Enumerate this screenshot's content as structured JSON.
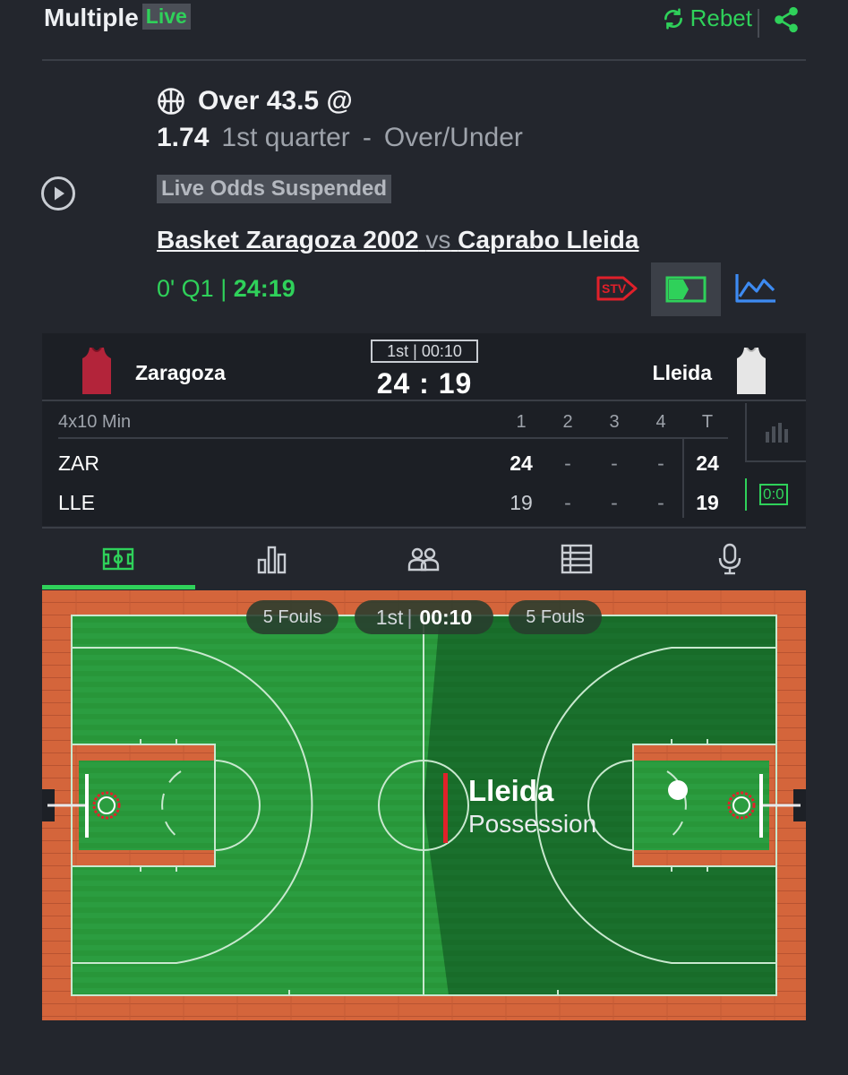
{
  "header": {
    "title": "Multiple",
    "live_badge": "Live",
    "rebet_label": "Rebet"
  },
  "bet": {
    "selection": "Over 43.5 @",
    "odds": "1.74",
    "period": "1st quarter",
    "separator": "-",
    "market": "Over/Under",
    "status": "Live Odds Suspended",
    "home_team": "Basket Zaragoza 2002",
    "vs": "vs",
    "away_team": "Caprabo Lleida",
    "clock_prefix": "0' Q1 |",
    "clock_time": "24:19"
  },
  "scoreboard": {
    "home": "Zaragoza",
    "away": "Lleida",
    "period_box": "1st | 00:10",
    "score": "24 : 19",
    "format": "4x10 Min",
    "headers": [
      "1",
      "2",
      "3",
      "4",
      "T"
    ],
    "rows": [
      {
        "abbr": "ZAR",
        "q1": "24",
        "q2": "-",
        "q3": "-",
        "q4": "-",
        "total": "24"
      },
      {
        "abbr": "LLE",
        "q1": "19",
        "q2": "-",
        "q3": "-",
        "q4": "-",
        "total": "19"
      }
    ],
    "serve_indicator": "0:0",
    "home_color": "#b3243a",
    "away_color": "#e6e6e6"
  },
  "tabs": [
    {
      "icon": "court-icon",
      "active": true
    },
    {
      "icon": "stats-bars-icon",
      "active": false
    },
    {
      "icon": "lineups-icon",
      "active": false
    },
    {
      "icon": "table-icon",
      "active": false
    },
    {
      "icon": "microphone-icon",
      "active": false
    }
  ],
  "court": {
    "home_fouls": "5 Fouls",
    "away_fouls": "5 Fouls",
    "period": "1st",
    "time": "00:10",
    "possession_team": "Lleida",
    "possession_label": "Possession"
  },
  "colors": {
    "accent": "#2fd15a",
    "background": "#23262d",
    "court_green": "#2a9a3f",
    "court_wood": "#d3643a"
  }
}
